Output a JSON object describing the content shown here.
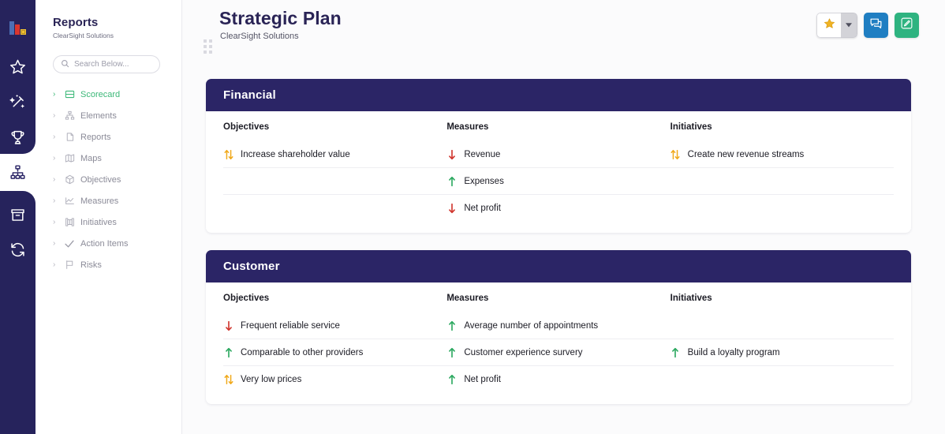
{
  "colors": {
    "navy": "#2B2566",
    "rail_navy": "#26235C",
    "green": "#3CB878",
    "blue_button": "#1F7EC2",
    "green_button": "#2EB380",
    "arrow_up": "#2BA85F",
    "arrow_down": "#D0342C",
    "arrow_updown": "#F0A818",
    "star_gold": "#F0B323"
  },
  "rail": {
    "items": [
      {
        "name": "logo-icon",
        "label": "Logo"
      },
      {
        "name": "star-icon",
        "label": "Favorites"
      },
      {
        "name": "magic-wand-icon",
        "label": "Insights"
      },
      {
        "name": "trophy-icon",
        "label": "Goals"
      },
      {
        "name": "org-chart-icon",
        "label": "Scorecards"
      },
      {
        "name": "archive-box-icon",
        "label": "Archive"
      },
      {
        "name": "sync-icon",
        "label": "Sync"
      }
    ],
    "active": "org-chart-icon"
  },
  "nav": {
    "title": "Reports",
    "subtitle": "ClearSight Solutions",
    "search": {
      "placeholder": "Search Below...",
      "value": "",
      "icon": "search-icon"
    },
    "items": [
      {
        "label": "Scorecard",
        "icon": "scorecard-icon",
        "active": true
      },
      {
        "label": "Elements",
        "icon": "elements-icon",
        "active": false
      },
      {
        "label": "Reports",
        "icon": "reports-icon",
        "active": false
      },
      {
        "label": "Maps",
        "icon": "maps-icon",
        "active": false
      },
      {
        "label": "Objectives",
        "icon": "objectives-icon",
        "active": false
      },
      {
        "label": "Measures",
        "icon": "measures-icon",
        "active": false
      },
      {
        "label": "Initiatives",
        "icon": "initiatives-icon",
        "active": false
      },
      {
        "label": "Action Items",
        "icon": "check-icon",
        "active": false
      },
      {
        "label": "Risks",
        "icon": "flag-icon",
        "active": false
      }
    ]
  },
  "header": {
    "drag_handle": "drag-handle-icon",
    "title": "Strategic Plan",
    "subtitle": "ClearSight Solutions",
    "actions": [
      {
        "name": "favorite-button",
        "icon": "star-icon",
        "style": "split"
      },
      {
        "name": "favorite-dropdown",
        "icon": "chevron-down-icon",
        "style": "caret"
      },
      {
        "name": "comment-button",
        "icon": "comment-icon",
        "style": "blue"
      },
      {
        "name": "edit-button",
        "icon": "edit-pencil-icon",
        "style": "green"
      }
    ]
  },
  "columns": [
    "Objectives",
    "Measures",
    "Initiatives"
  ],
  "cards": [
    {
      "title": "Financial",
      "objectives": [
        {
          "text": "Increase shareholder value",
          "trend": "updown"
        }
      ],
      "measures": [
        {
          "text": "Revenue",
          "trend": "down"
        },
        {
          "text": "Expenses",
          "trend": "up"
        },
        {
          "text": "Net profit",
          "trend": "down"
        }
      ],
      "initiatives": [
        {
          "text": "Create new revenue streams",
          "trend": "updown"
        }
      ]
    },
    {
      "title": "Customer",
      "objectives": [
        {
          "text": "Frequent reliable service",
          "trend": "down"
        },
        {
          "text": "Comparable to other providers",
          "trend": "up"
        },
        {
          "text": "Very low prices",
          "trend": "updown"
        }
      ],
      "measures": [
        {
          "text": "Average number of appointments",
          "trend": "up"
        },
        {
          "text": "Customer experience survery",
          "trend": "up"
        },
        {
          "text": "Net profit",
          "trend": "up"
        }
      ],
      "initiatives": [
        {
          "text": "Build a loyalty program",
          "trend": "up"
        }
      ]
    }
  ]
}
